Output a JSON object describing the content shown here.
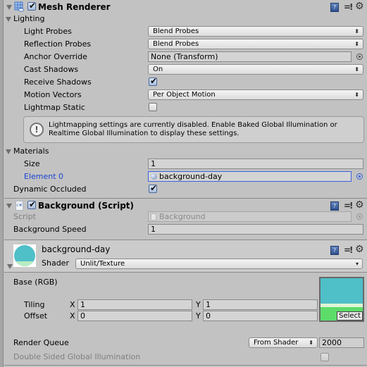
{
  "mesh_renderer": {
    "title": "Mesh Renderer",
    "enabled": true,
    "lighting": {
      "header": "Lighting",
      "light_probes": {
        "label": "Light Probes",
        "value": "Blend Probes"
      },
      "reflection_probes": {
        "label": "Reflection Probes",
        "value": "Blend Probes"
      },
      "anchor_override": {
        "label": "Anchor Override",
        "value": "None (Transform)"
      },
      "cast_shadows": {
        "label": "Cast Shadows",
        "value": "On"
      },
      "receive_shadows": {
        "label": "Receive Shadows",
        "checked": true
      },
      "motion_vectors": {
        "label": "Motion Vectors",
        "value": "Per Object Motion"
      },
      "lightmap_static": {
        "label": "Lightmap Static",
        "checked": false
      },
      "help_line1": "Lightmapping settings are currently disabled. Enable Baked Global Illumination or",
      "help_line2": "Realtime Global Illumination to display these settings."
    },
    "materials": {
      "header": "Materials",
      "size": {
        "label": "Size",
        "value": "1"
      },
      "element0": {
        "label": "Element 0",
        "value": "background-day"
      }
    },
    "dynamic_occluded": {
      "label": "Dynamic Occluded",
      "checked": true
    }
  },
  "background_script": {
    "title": "Background (Script)",
    "enabled": true,
    "script": {
      "label": "Script",
      "value": "Background"
    },
    "speed": {
      "label": "Background Speed",
      "value": "1"
    }
  },
  "material": {
    "name": "background-day",
    "shader_label": "Shader",
    "shader_value": "Unlit/Texture",
    "base_label": "Base (RGB)",
    "tiling": {
      "label": "Tiling",
      "x_label": "X",
      "x": "1",
      "y_label": "Y",
      "y": "1"
    },
    "offset": {
      "label": "Offset",
      "x_label": "X",
      "x": "0",
      "y_label": "Y",
      "y": "0"
    },
    "select_label": "Select",
    "render_queue": {
      "label": "Render Queue",
      "mode": "From Shader",
      "value": "2000"
    },
    "double_sided_gi": {
      "label": "Double Sided Global Illumination",
      "checked": false
    }
  },
  "icons": {
    "help": "?",
    "preset": "=!",
    "gear": "⚙",
    "info": "!",
    "popup_arrow": "⬍",
    "dropdown_arrow": "▾"
  }
}
